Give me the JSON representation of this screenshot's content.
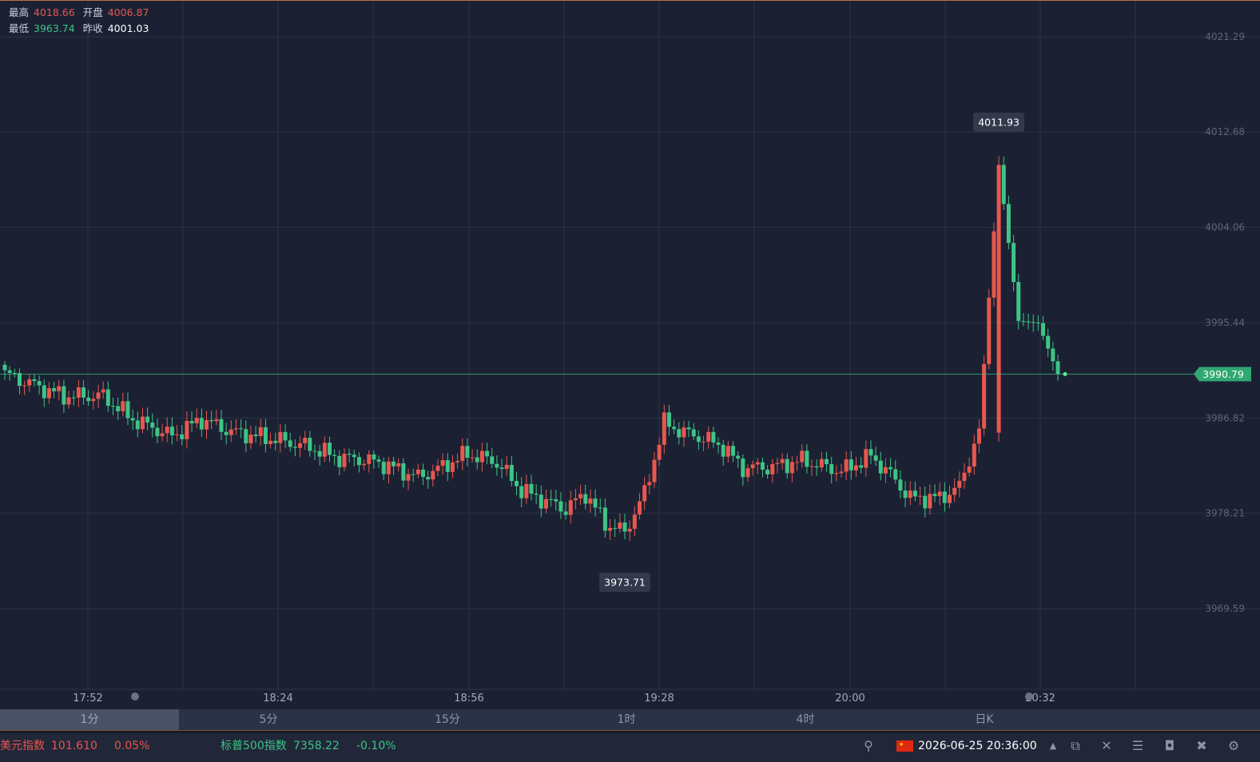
{
  "info": {
    "high_label": "最高",
    "high_value": "4018.66",
    "open_label": "开盘",
    "open_value": "4006.87",
    "low_label": "最低",
    "low_value": "3963.74",
    "prev_close_label": "昨收",
    "prev_close_value": "4001.03"
  },
  "chart_data": {
    "type": "candlestick",
    "y_ticks": [
      "4021.29",
      "4012.68",
      "4004.06",
      "3995.44",
      "3986.82",
      "3978.21",
      "3969.59"
    ],
    "y_tick_values": [
      4021.29,
      4012.68,
      4004.06,
      3995.44,
      3986.82,
      3978.21,
      3969.59
    ],
    "x_ticks": [
      "17:52",
      "18:24",
      "18:56",
      "19:28",
      "20:00",
      "20:32"
    ],
    "last_price": "3990.79",
    "max_marker": "4011.93",
    "min_marker": "3973.71",
    "grid": true,
    "colors": {
      "up": "#e8574e",
      "down": "#3ec486",
      "background": "#1b2133",
      "grid": "#2b3246"
    }
  },
  "timeframes": [
    "1分",
    "5分",
    "15分",
    "1时",
    "4时",
    "日K"
  ],
  "active_timeframe": "1分",
  "status": {
    "dxy_name": "美元指数",
    "dxy_value": "101.610",
    "dxy_change": "0.05%",
    "spx_name": "标普500指数",
    "spx_value": "7358.22",
    "spx_change": "-0.10%",
    "datetime": "2026-06-25 20:36:00"
  },
  "status_icons": [
    "unlink-icon",
    "expand-up-icon",
    "chart-icon",
    "tools-icon",
    "menu-icon",
    "screenshot-icon",
    "mute-icon",
    "settings-icon"
  ]
}
